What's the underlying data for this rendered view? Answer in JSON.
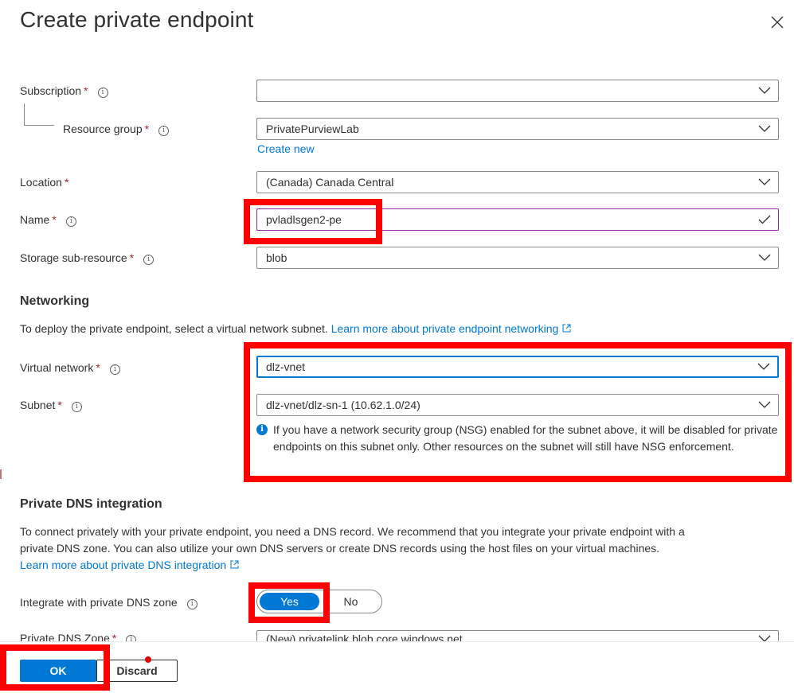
{
  "dialog": {
    "title": "Create private endpoint"
  },
  "form": {
    "subscription": {
      "label": "Subscription",
      "required": "*",
      "value": ""
    },
    "resource_group": {
      "label": "Resource group",
      "required": "*",
      "value": "PrivatePurviewLab",
      "create_new": "Create new"
    },
    "location": {
      "label": "Location",
      "required": "*",
      "value": "(Canada) Canada Central"
    },
    "name": {
      "label": "Name",
      "required": "*",
      "value": "pvladlsgen2-pe"
    },
    "storage_sub_resource": {
      "label": "Storage sub-resource",
      "required": "*",
      "value": "blob"
    }
  },
  "networking": {
    "heading": "Networking",
    "description": "To deploy the private endpoint, select a virtual network subnet.",
    "learn_more": "Learn more about private endpoint networking",
    "virtual_network": {
      "label": "Virtual network",
      "required": "*",
      "value": "dlz-vnet"
    },
    "subnet": {
      "label": "Subnet",
      "required": "*",
      "value": "dlz-vnet/dlz-sn-1 (10.62.1.0/24)"
    },
    "nsg_note": "If you have a network security group (NSG) enabled for the subnet above, it will be disabled for private endpoints on this subnet only. Other resources on the subnet will still have NSG enforcement."
  },
  "dns": {
    "heading": "Private DNS integration",
    "description_line1": "To connect privately with your private endpoint, you need a DNS record. We recommend that you integrate your private endpoint with a",
    "description_line2": "private DNS zone. You can also utilize your own DNS servers or create DNS records using the host files on your virtual machines.",
    "learn_more": "Learn more about private DNS integration",
    "integrate": {
      "label": "Integrate with private DNS zone",
      "yes": "Yes",
      "no": "No",
      "selected": "Yes"
    },
    "zone": {
      "label": "Private DNS Zone",
      "required": "*",
      "value": "(New) privatelink.blob.core.windows.net"
    }
  },
  "footer": {
    "ok_label": "OK",
    "discard_label": "Discard"
  },
  "icons": {
    "close": "close-icon",
    "chevron": "chevron-down-icon",
    "info": "info-icon",
    "external": "external-link-icon",
    "check": "checkmark-icon"
  },
  "colors": {
    "accent": "#0078d4",
    "required": "#a4262c",
    "highlight": "#ff0000",
    "name_border": "#8a2da5"
  }
}
